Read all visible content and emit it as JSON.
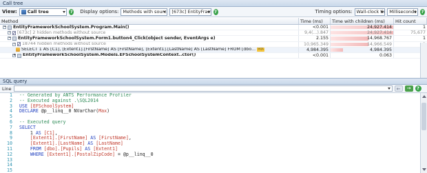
{
  "panel": {
    "title": "Call tree"
  },
  "toolbar": {
    "view_label": "View:",
    "view_value": "Call tree",
    "display_label": "Display options:",
    "display_value": "Methods with source",
    "thread_value": "[673c] EntityFramework...",
    "timing_label": "Timing options:",
    "timing_value": "Wall-clock time",
    "units_value": "Milliseconds"
  },
  "grid": {
    "columns": [
      "Method",
      "Time (ms)",
      "Time with children (ms)",
      "Hit count"
    ],
    "rows": [
      {
        "indent": 0,
        "exp": "-",
        "kind": "method",
        "method": "EntityFrameworkSchoolSystem.Program.Main()",
        "time": "<0.001",
        "with_children": "24,927.414",
        "fill": 1.0,
        "hits": "1",
        "style": "bold"
      },
      {
        "indent": 1,
        "exp": "+",
        "kind": "hidden",
        "method": "[673c] 2 hidden methods without source",
        "time": "9,4(...).847",
        "with_children": "24,927.414",
        "fill": 1.0,
        "hits": "75,677",
        "style": "gray"
      },
      {
        "indent": 1,
        "exp": "-",
        "kind": "method",
        "method": "EntityFrameworkSchoolSystem.Form1.button4_Click(object sender, EventArgs e)",
        "time": "2.155",
        "with_children": "14,968.767",
        "fill": 0.6,
        "hits": "1",
        "style": "bold"
      },
      {
        "indent": 2,
        "exp": "+",
        "kind": "hidden",
        "method": "18744 hidden methods without source",
        "time": "10,965.349",
        "with_children": "14,966.549",
        "fill": 0.6,
        "hits": "1",
        "style": "gray"
      },
      {
        "indent": 3,
        "exp": "",
        "kind": "sql",
        "method": "SELECT  1 AS [C1], [Extent1].[FirstName] AS [FirstName], [Extent1].[LastName] AS [LastName]  FROM [dbo...",
        "badge": "SQL",
        "time": "4,984.395",
        "with_children": "4,984.395",
        "fill": 0.2,
        "hits": "1",
        "style": "sel"
      },
      {
        "indent": 2,
        "exp": "+",
        "kind": "method",
        "method": "EntityFrameworkSchoolSystem.Models.EFSchoolSystemContext..ctor()",
        "time": "<0.001",
        "with_children": "0.063",
        "fill": 0.0,
        "hits": "1",
        "style": "bold"
      }
    ]
  },
  "sql": {
    "title": "SQL query",
    "line_label": "Line",
    "lines": [
      [
        [
          "cm",
          "-- Generated by ANTS Performance Profiler"
        ]
      ],
      [
        [
          "cm",
          "-- Executed against .\\SQL2014"
        ]
      ],
      [
        [
          "kw",
          "USE "
        ],
        [
          "id",
          "[EFSchoolSystem]"
        ]
      ],
      [
        [
          "kw",
          "DECLARE "
        ],
        [
          "",
          "@p__linq__0 NVarChar("
        ],
        [
          "id",
          "Max"
        ],
        [
          "",
          ")"
        ]
      ],
      [],
      [
        [
          "cm",
          "-- Executed query"
        ]
      ],
      [
        [
          "kw",
          "SELECT"
        ]
      ],
      [
        [
          "",
          "    1 "
        ],
        [
          "kw",
          "AS "
        ],
        [
          "id",
          "[C1]"
        ],
        [
          "",
          ","
        ]
      ],
      [
        [
          "",
          "    "
        ],
        [
          "id",
          "[Extent1].[FirstName]"
        ],
        [
          "kw",
          " AS "
        ],
        [
          "id",
          "[FirstName]"
        ],
        [
          "",
          ","
        ]
      ],
      [
        [
          "",
          "    "
        ],
        [
          "id",
          "[Extent1].[LastName]"
        ],
        [
          "kw",
          " AS "
        ],
        [
          "id",
          "[LastName]"
        ]
      ],
      [
        [
          "",
          "    "
        ],
        [
          "kw",
          "FROM "
        ],
        [
          "id",
          "[dbo].[Pupils]"
        ],
        [
          "kw",
          " AS "
        ],
        [
          "id",
          "[Extent1]"
        ]
      ],
      [
        [
          "",
          "    "
        ],
        [
          "kw",
          "WHERE "
        ],
        [
          "id",
          "[Extent1].[PostalZipCode]"
        ],
        [
          "",
          " = @p__linq__0"
        ]
      ],
      [],
      [],
      []
    ],
    "line_numbers": [
      "1",
      "2",
      "3",
      "4",
      "5",
      "6",
      "7",
      "8",
      "9",
      "10",
      "11",
      "12",
      "13",
      "14",
      "15"
    ]
  }
}
